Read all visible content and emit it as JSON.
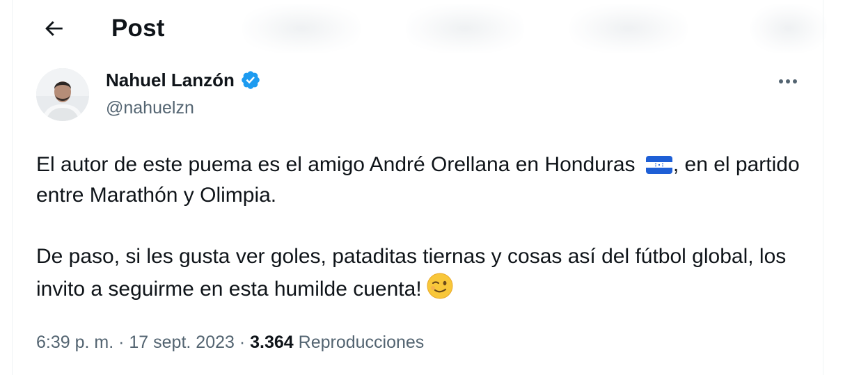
{
  "header": {
    "title": "Post",
    "back_icon": "arrow-left-icon"
  },
  "author": {
    "name": "Nahuel Lanzón",
    "handle": "@nahuelzn",
    "verified": true,
    "verified_icon": "verified-badge-icon",
    "verified_color": "#1d9bf0"
  },
  "post": {
    "paragraph_1_before_flag": "El autor de este puema es el amigo André Orellana en Honduras",
    "paragraph_1_after_flag": ", en el partido entre Marathón y Olimpia.",
    "flag_icon": "honduras-flag-icon",
    "paragraph_2": "De paso, si les gusta ver goles, pataditas tiernas y cosas así del fútbol global, los invito a seguirme en esta humilde cuenta!",
    "emoji_icon": "winking-face-icon"
  },
  "meta": {
    "time": "6:39 p. m.",
    "separator": " · ",
    "date": "17 sept. 2023",
    "views_count": "3.364",
    "views_label": "Reproducciones"
  },
  "colors": {
    "text_primary": "#0f1419",
    "text_secondary": "#536471",
    "accent": "#1d9bf0",
    "border": "#eff3f4"
  }
}
